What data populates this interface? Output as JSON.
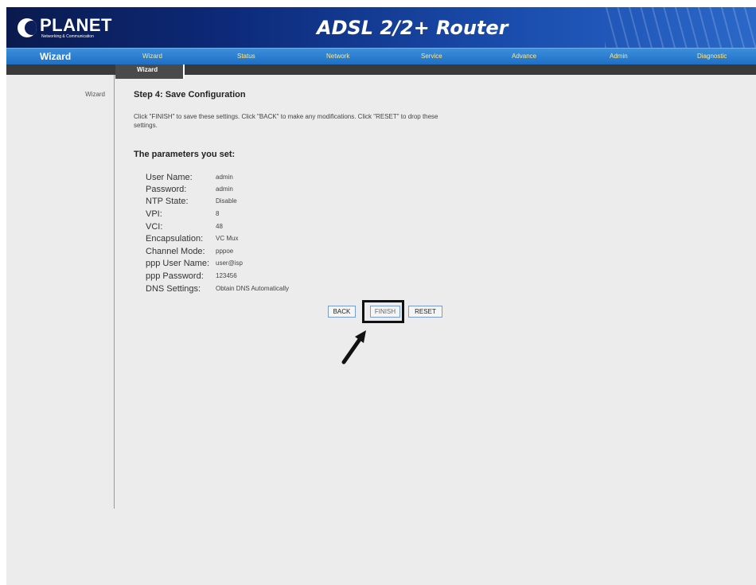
{
  "header": {
    "logo_name": "PLANET",
    "logo_tagline": "Networking & Communication",
    "title": "ADSL 2/2+ Router"
  },
  "nav": {
    "active_section": "Wizard",
    "items": [
      {
        "label": "Wizard"
      },
      {
        "label": "Status"
      },
      {
        "label": "Network"
      },
      {
        "label": "Service"
      },
      {
        "label": "Advance"
      },
      {
        "label": "Admin"
      },
      {
        "label": "Diagnostic"
      }
    ],
    "color": "#ffe98a"
  },
  "subnav": {
    "active_tab": "Wizard"
  },
  "sidebar": {
    "items": [
      {
        "label": "Wizard"
      }
    ]
  },
  "main": {
    "step_title": "Step 4: Save Configuration",
    "description": "Click \"FINISH\" to save these settings. Click \"BACK\" to make any modifications. Click \"RESET\" to drop these settings.",
    "params_title": "The parameters you set:",
    "params": [
      {
        "label": "User Name:",
        "value": "admin"
      },
      {
        "label": "Password:",
        "value": "admin"
      },
      {
        "label": "NTP State:",
        "value": "Disable"
      },
      {
        "label": "VPI:",
        "value": "8"
      },
      {
        "label": "VCI:",
        "value": "48"
      },
      {
        "label": "Encapsulation:",
        "value": "VC Mux"
      },
      {
        "label": "Channel Mode:",
        "value": "pppoe"
      },
      {
        "label": "ppp User Name:",
        "value": "user@isp"
      },
      {
        "label": "ppp Password:",
        "value": "123456"
      },
      {
        "label": "DNS Settings:",
        "value": "Obtain DNS Automatically"
      }
    ],
    "buttons": {
      "back": "BACK",
      "finish": "FINISH",
      "reset": "RESET"
    }
  },
  "colors": {
    "header_dark": "#0a1a4e",
    "navbar": "#1f6fc4",
    "subnav": "#3a3a3a",
    "background": "#ececec"
  }
}
